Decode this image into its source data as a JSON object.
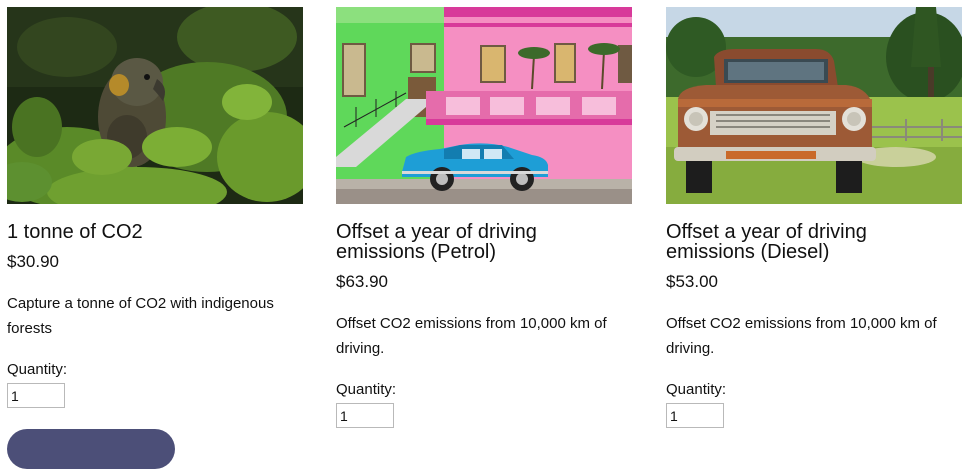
{
  "products": [
    {
      "title": "1 tonne of CO2",
      "price": "$30.90",
      "description": "Capture a tonne of CO2 with indigenous forests",
      "quantity_label": "Quantity:",
      "quantity_value": "1",
      "image_icon": "kaka-parrot-photo"
    },
    {
      "title": "Offset a year of driving emissions (Petrol)",
      "price": "$63.90",
      "description": "Offset CO2 emissions from 10,000 km of driving.",
      "quantity_label": "Quantity:",
      "quantity_value": "1",
      "image_icon": "blue-car-pink-house-photo"
    },
    {
      "title": "Offset a year of driving emissions (Diesel)",
      "price": "$53.00",
      "description": "Offset CO2 emissions from 10,000 km of driving.",
      "quantity_label": "Quantity:",
      "quantity_value": "1",
      "image_icon": "rusty-truck-photo"
    }
  ],
  "colors": {
    "button": "#4c4f78",
    "text": "#111111",
    "input_border": "#b9b9b9"
  }
}
